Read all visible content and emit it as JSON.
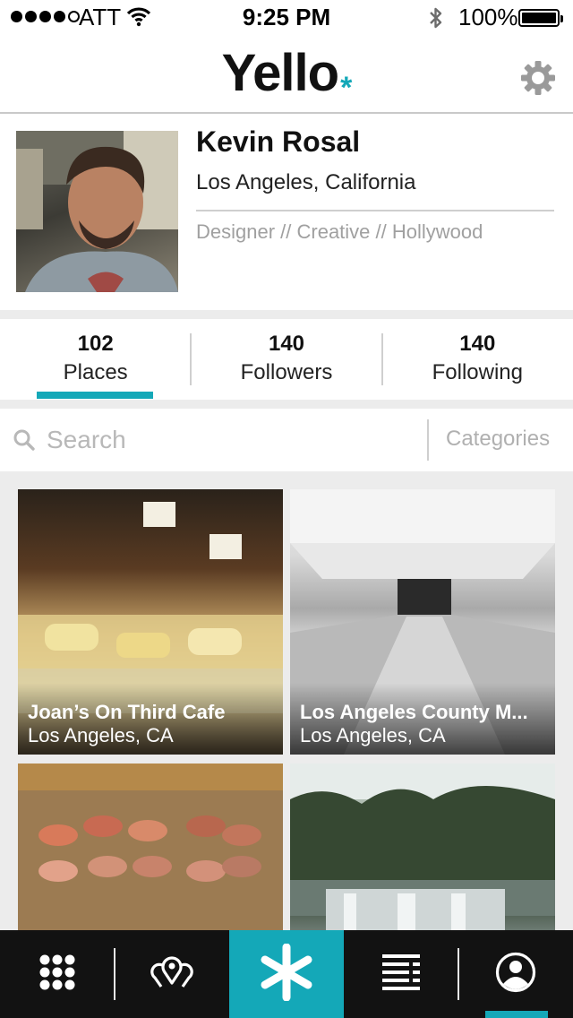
{
  "status_bar": {
    "carrier": "ATT",
    "time": "9:25 PM",
    "battery_percent": "100%",
    "signal_bars_filled": 4,
    "signal_bars_total": 5
  },
  "header": {
    "logo_text": "Yello",
    "logo_mark": "*",
    "settings_icon": "gear-icon"
  },
  "profile": {
    "name": "Kevin Rosal",
    "location": "Los Angeles, California",
    "tags": "Designer // Creative // Hollywood"
  },
  "stats": [
    {
      "count": "102",
      "label": "Places",
      "selected": true
    },
    {
      "count": "140",
      "label": "Followers",
      "selected": false
    },
    {
      "count": "140",
      "label": "Following",
      "selected": false
    }
  ],
  "search": {
    "placeholder": "Search",
    "categories_label": "Categories"
  },
  "places": [
    {
      "title": "Joan’s On Third Cafe",
      "subtitle": "Los Angeles, CA"
    },
    {
      "title": "Los Angeles County M...",
      "subtitle": "Los Angeles, CA"
    },
    {
      "title": "",
      "subtitle": ""
    },
    {
      "title": "",
      "subtitle": ""
    }
  ],
  "tab_bar": {
    "items": [
      {
        "icon": "grid-icon",
        "active": false
      },
      {
        "icon": "map-pins-icon",
        "active": false
      },
      {
        "icon": "asterisk-icon",
        "active": true
      },
      {
        "icon": "list-icon",
        "active": false
      },
      {
        "icon": "profile-icon",
        "active": false
      }
    ]
  },
  "colors": {
    "accent": "#14a8b8",
    "tab_bar_bg": "#121212",
    "band_gray": "#ececec"
  }
}
